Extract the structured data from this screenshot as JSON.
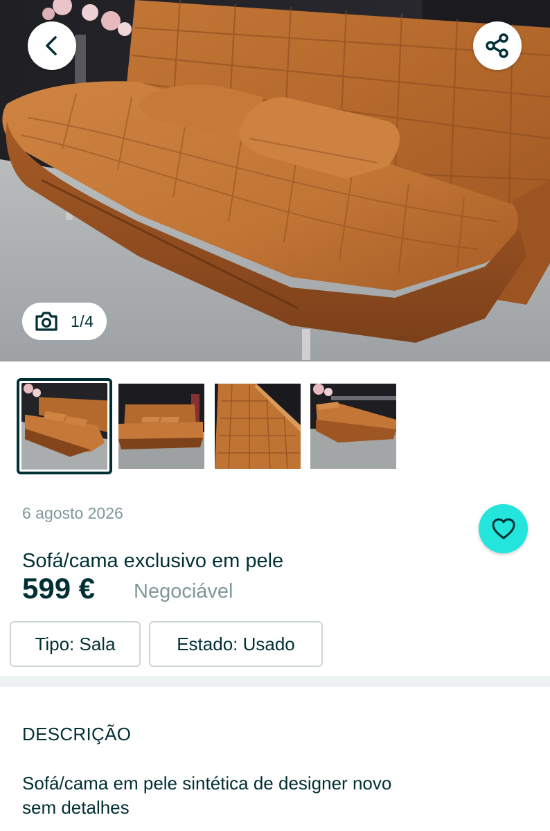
{
  "gallery": {
    "counter": "1/4",
    "thumbnails": [
      "sofa-photo-1",
      "sofa-photo-2",
      "sofa-photo-3",
      "sofa-photo-4"
    ],
    "active_index": 0
  },
  "toolbar": {
    "back_icon": "chevron-left-icon",
    "share_icon": "share-icon"
  },
  "listing": {
    "date": "6 agosto 2026",
    "title": "Sofá/cama exclusivo em pele",
    "price": "599 €",
    "negotiable": "Negociável",
    "favorite_icon": "heart-icon"
  },
  "attributes": [
    {
      "text": "Tipo: Sala"
    },
    {
      "text": "Estado: Usado"
    }
  ],
  "description": {
    "heading": "DESCRIÇÃO",
    "lines": [
      "Sofá/cama em pele sintética de designer novo",
      "sem detalhes"
    ]
  },
  "colors": {
    "primary_text": "#002f34",
    "muted_text": "#7f9799",
    "accent": "#23e5db",
    "leather": "#b8682c"
  }
}
